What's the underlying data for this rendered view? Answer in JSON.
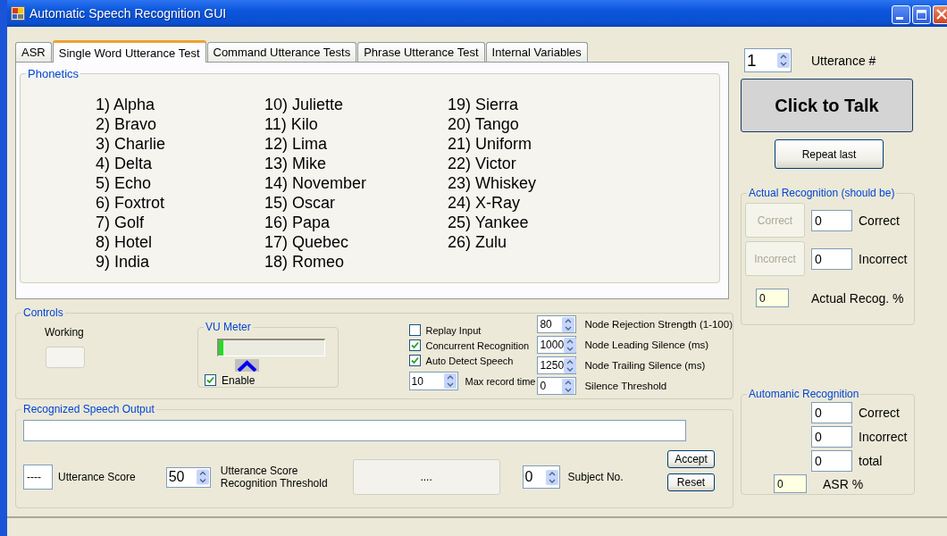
{
  "window": {
    "title": "Automatic Speech Recognition GUI"
  },
  "tabs": [
    {
      "label": "ASR",
      "selected": false
    },
    {
      "label": "Single Word Utterance Test",
      "selected": true
    },
    {
      "label": "Command Utterance Tests",
      "selected": false
    },
    {
      "label": "Phrase Utterance Test",
      "selected": false
    },
    {
      "label": "Internal Variables",
      "selected": false
    }
  ],
  "phonetics": {
    "title": "Phonetics",
    "columns": [
      [
        "1) Alpha",
        "2) Bravo",
        "3) Charlie",
        "4) Delta",
        "5) Echo",
        "6) Foxtrot",
        "7) Golf",
        "8) Hotel",
        "9) India"
      ],
      [
        "10) Juliette",
        "11) Kilo",
        "12) Lima",
        "13) Mike",
        "14) November",
        "15) Oscar",
        "16) Papa",
        "17) Quebec",
        "18) Romeo"
      ],
      [
        "19) Sierra",
        "20) Tango",
        "21) Uniform",
        "22) Victor",
        "23) Whiskey",
        "24) X-Ray",
        "25) Yankee",
        "26) Zulu"
      ]
    ]
  },
  "controls": {
    "title": "Controls",
    "working": {
      "label": "Working"
    },
    "vu_meter": {
      "title": "VU Meter",
      "level": 0.04,
      "enable": {
        "label": "Enable",
        "checked": true
      }
    },
    "checkboxes": [
      {
        "label": "Replay Input",
        "checked": false
      },
      {
        "label": "Concurrent Recognition",
        "checked": true
      },
      {
        "label": "Auto Detect Speech",
        "checked": true
      }
    ],
    "max_record_time": {
      "value": "10",
      "label": "Max record time"
    },
    "node_settings": [
      {
        "value": "80",
        "label": "Node Rejection Strength (1-100)"
      },
      {
        "value": "1000",
        "label": "Node Leading Silence (ms)"
      },
      {
        "value": "1250",
        "label": "Node Trailing Silence (ms)"
      },
      {
        "value": "0",
        "label": "Silence Threshold"
      }
    ]
  },
  "speech_output": {
    "title": "Recognized Speech Output",
    "utterance_score": {
      "value": "----",
      "label": "Utterance Score"
    },
    "threshold": {
      "value": "50",
      "label_lines": [
        "Utterance Score",
        "Recognition Threshold"
      ]
    },
    "result_button": "....",
    "subject": {
      "value": "0",
      "label": "Subject No."
    },
    "buttons": [
      "Accept",
      "Reset"
    ]
  },
  "utterance": {
    "value": "1",
    "label": "Utterance #"
  },
  "talk_button": "Click to Talk",
  "repeat_button": "Repeat last",
  "actual_recognition": {
    "title": "Actual Recognition (should be)",
    "rows": [
      {
        "button": "Correct",
        "disabled": true,
        "value": "0",
        "label": "Correct"
      },
      {
        "button": "Incorrect",
        "disabled": true,
        "value": "0",
        "label": "Incorrect"
      }
    ],
    "percent": {
      "value": "0",
      "label": "Actual Recog. %"
    }
  },
  "automatic_recognition": {
    "title": "Automanic Recognition",
    "rows": [
      {
        "value": "0",
        "label": "Correct"
      },
      {
        "value": "0",
        "label": "Incorrect"
      },
      {
        "value": "0",
        "label": "total"
      }
    ],
    "percent": {
      "value": "0",
      "label": "ASR %"
    }
  }
}
